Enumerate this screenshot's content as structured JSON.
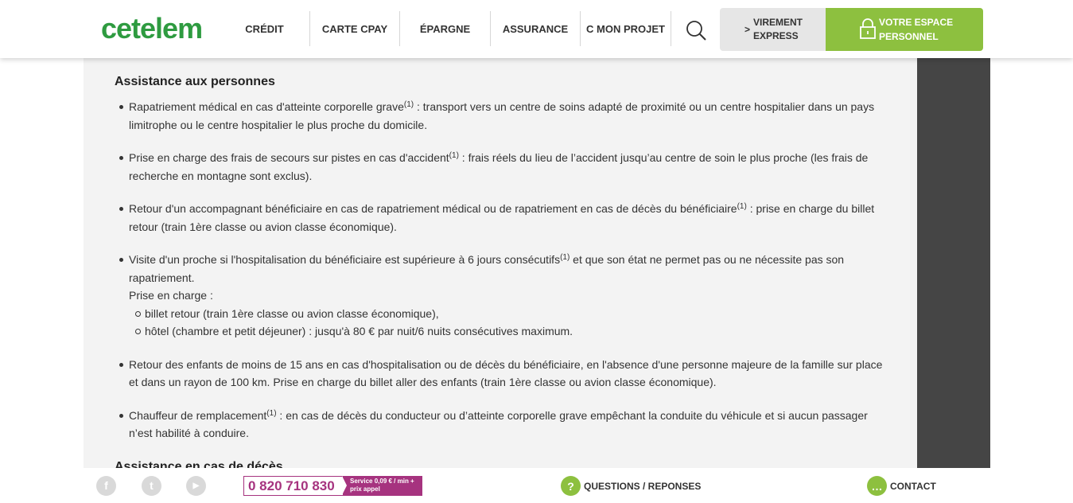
{
  "brand": {
    "logo_text": "cetelem",
    "accent": "#8dc03f",
    "logo_color": "#2e9b40"
  },
  "nav": {
    "items": [
      {
        "label": "CRÉDIT"
      },
      {
        "label": "CARTE CPAY"
      },
      {
        "label": "ÉPARGNE"
      },
      {
        "label": "ASSURANCE"
      },
      {
        "label": "C MON PROJET"
      }
    ],
    "search_icon": "search-icon",
    "virement": {
      "arrow": ">",
      "label": "VIREMENT EXPRESS"
    },
    "espace": {
      "label": "VOTRE ESPACE PERSONNEL",
      "icon": "lock-icon"
    }
  },
  "content": {
    "title": "Assistance aux personnes",
    "items": [
      {
        "text": "Rapatriement médical en cas d'atteinte corporelle grave",
        "sup": "(1)",
        "rest": " : transport vers un centre de soins adapté de proximité ou un centre hospitalier dans un pays limitrophe ou le centre hospitalier le plus proche du domicile."
      },
      {
        "text": "Prise en charge des frais de secours sur pistes en cas d'accident",
        "sup": "(1)",
        "rest": " : frais réels du lieu de l’accident jusqu’au centre de soin le plus proche (les frais de recherche en montagne sont exclus)."
      },
      {
        "text": "Retour d'un accompagnant bénéficiaire en cas de rapatriement médical ou de rapatriement en cas de décès du bénéficiaire",
        "sup": "(1)",
        "rest": " : prise en charge du billet retour (train 1ère classe ou avion classe économique)."
      },
      {
        "text": "Visite d'un proche si l'hospitalisation du bénéficiaire est supérieure à 6 jours consécutifs",
        "sup": "(1)",
        "rest": " et que son état ne permet pas ou ne nécessite pas son rapatriement.",
        "extra": "Prise en charge :",
        "sub": [
          "billet retour (train 1ère classe ou avion classe économique),",
          "hôtel (chambre et petit déjeuner) : jusqu'à 80 € par nuit/6 nuits consécutives maximum."
        ]
      },
      {
        "text": "Retour des enfants de moins de 15 ans en cas d'hospitalisation ou de décès du bénéficiaire, en l'absence d'une personne majeure de la famille sur place et dans un rayon de 100 km. Prise en charge du billet aller des enfants (train 1ère classe ou avion classe économique).",
        "sup": "",
        "rest": ""
      },
      {
        "text": "Chauffeur de remplacement",
        "sup": "(1)",
        "rest": " : en cas de décès du conducteur ou d’atteinte corporelle grave empêchant la conduite du véhicule et si aucun passager n’est habilité à conduire."
      }
    ],
    "next_title": "Assistance en cas de décès"
  },
  "footer": {
    "social": [
      {
        "icon": "facebook-icon",
        "glyph": "f"
      },
      {
        "icon": "twitter-icon",
        "glyph": "t"
      },
      {
        "icon": "youtube-icon",
        "glyph": "▶"
      }
    ],
    "phone": {
      "number": "0 820 710 830",
      "tag": "Service 0,09 € / min + prix appel",
      "color": "#a6337f"
    },
    "faq": {
      "label": "QUESTIONS / REPONSES",
      "glyph": "?"
    },
    "contact": {
      "label": "CONTACT",
      "glyph": "…"
    }
  }
}
